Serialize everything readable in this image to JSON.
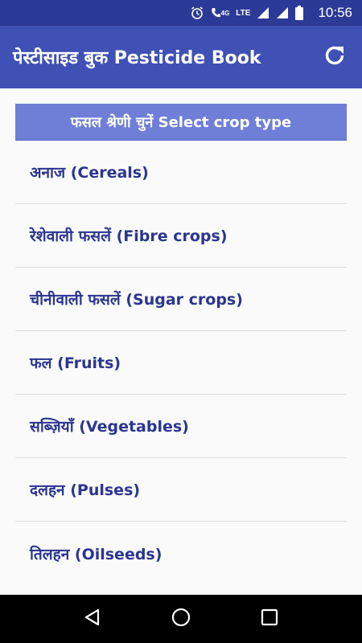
{
  "status_bar": {
    "time": "10:56",
    "network_label": "4G",
    "lte_label": "LTE",
    "icons": [
      "alarm-icon",
      "wifi-call-icon",
      "signal-icon",
      "signal-icon",
      "battery-icon"
    ]
  },
  "app_bar": {
    "title": "पेस्टीसाइड बुक Pesticide Book",
    "action_icon": "refresh-icon"
  },
  "header": {
    "label": "फसल श्रेणी चुनें Select crop type"
  },
  "crop_types": [
    {
      "label": "अनाज (Cereals)"
    },
    {
      "label": "रेशेवाली फसलें (Fibre crops)"
    },
    {
      "label": "चीनीवाली फसलें (Sugar crops)"
    },
    {
      "label": "फल (Fruits)"
    },
    {
      "label": "सब्ज़ियाँ (Vegetables)"
    },
    {
      "label": "दलहन (Pulses)"
    },
    {
      "label": "तिलहन (Oilseeds)"
    }
  ],
  "nav_bar": {
    "icons": [
      "back-icon",
      "home-icon",
      "recents-icon"
    ]
  },
  "colors": {
    "status_bar": "#2c3a97",
    "app_bar": "#3f51b5",
    "header_banner": "#6f7fd7",
    "list_text": "#2b3590"
  }
}
